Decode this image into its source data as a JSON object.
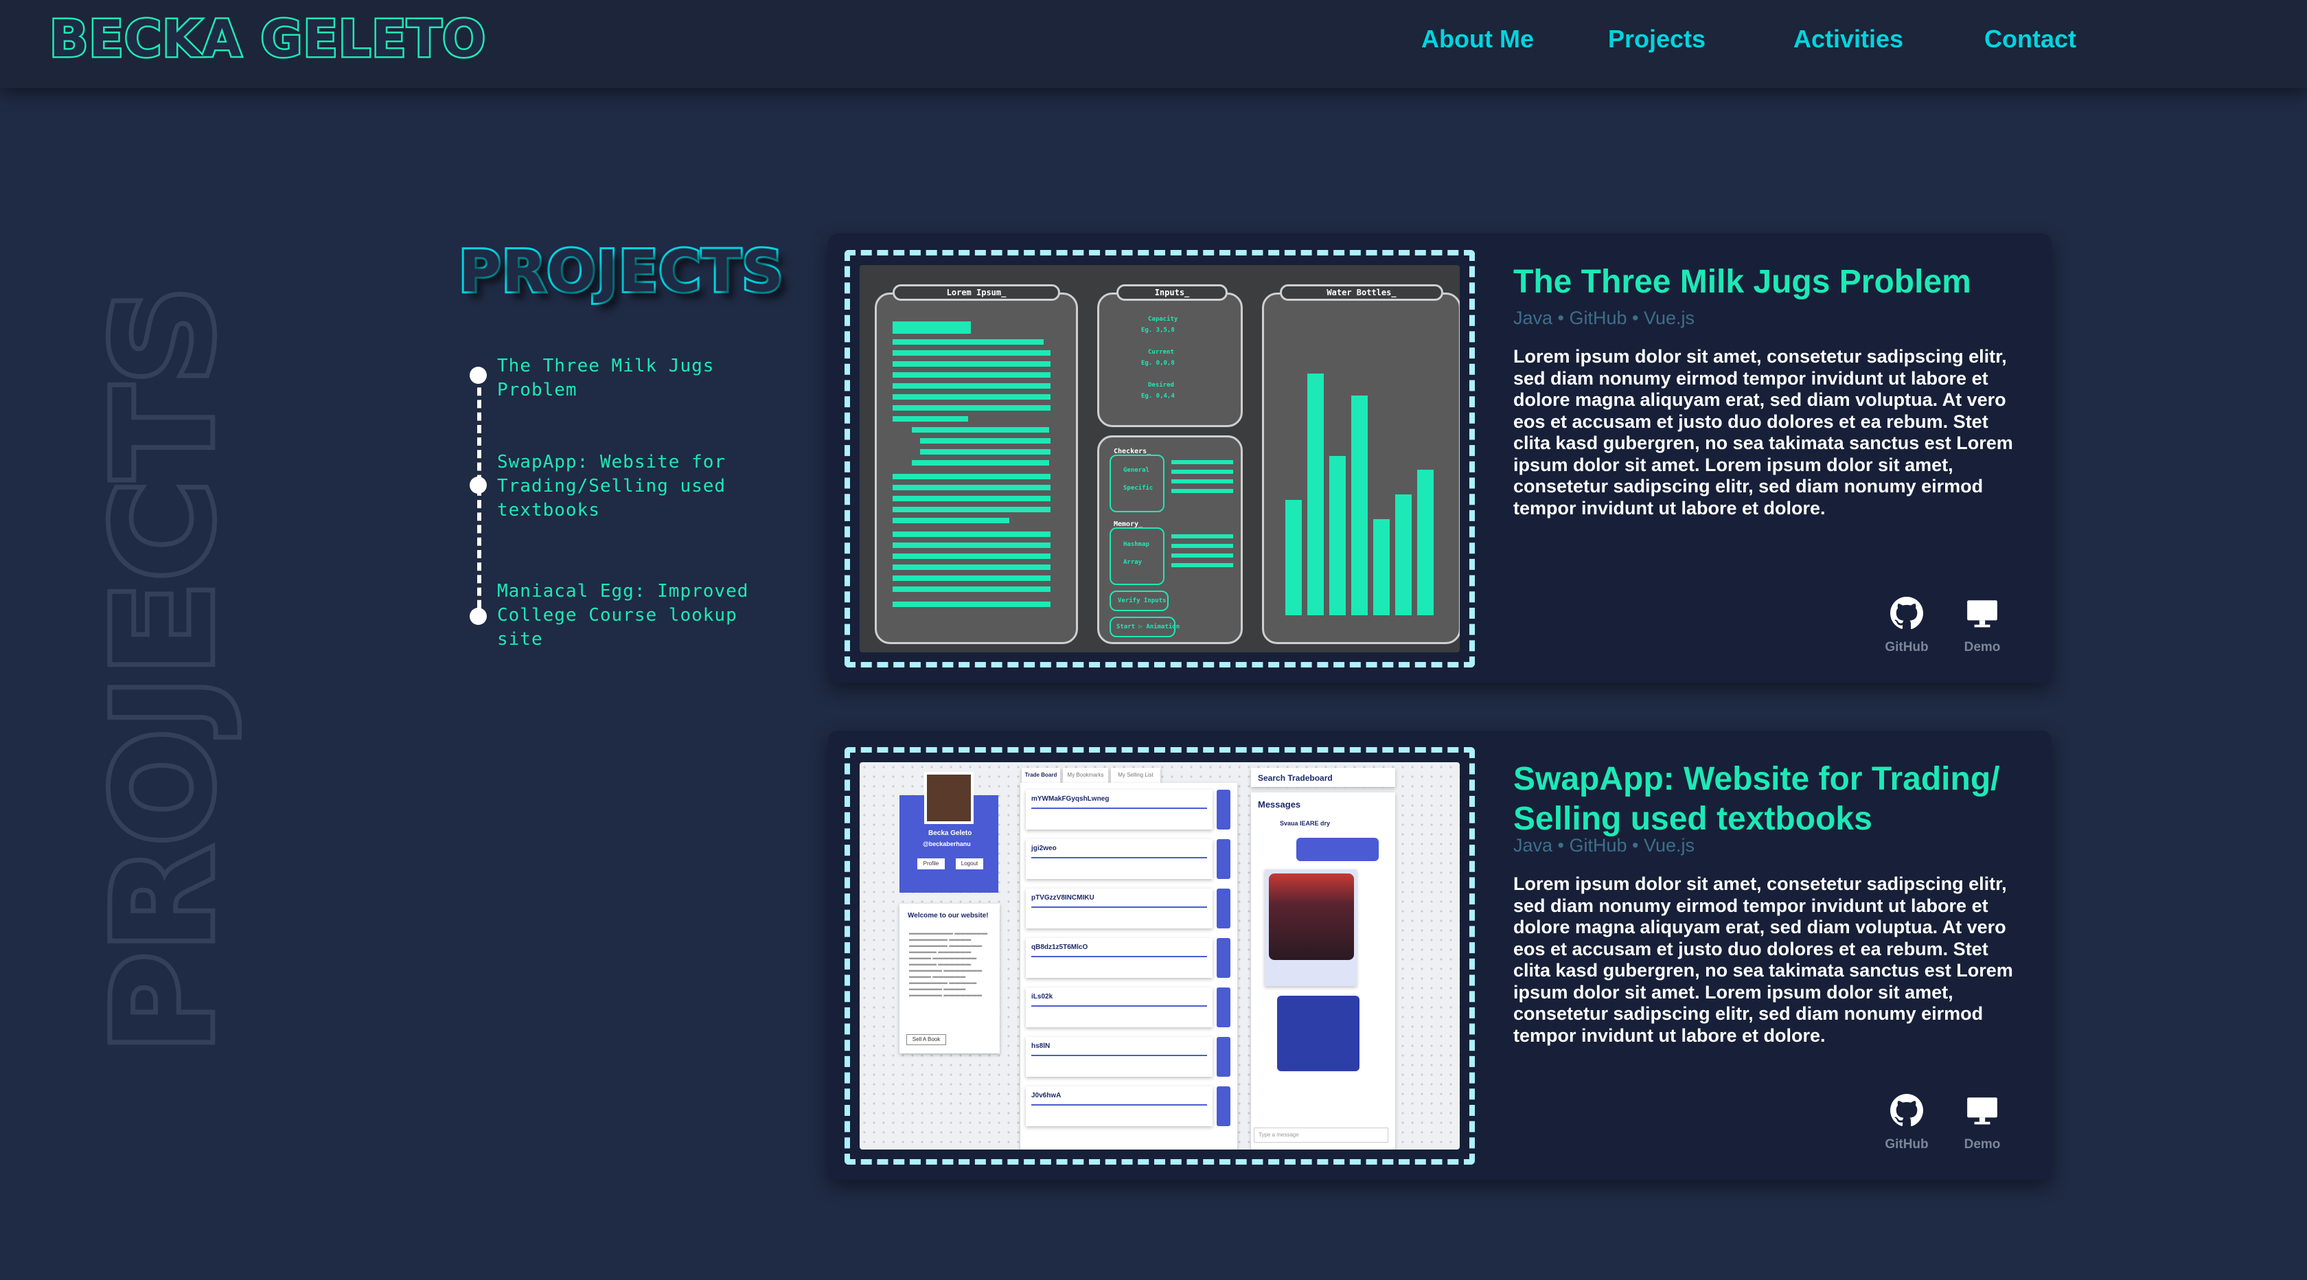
{
  "header": {
    "brand": "BECKA GELETO",
    "nav": [
      {
        "label": "About Me"
      },
      {
        "label": "Projects"
      },
      {
        "label": "Activities"
      },
      {
        "label": "Contact"
      }
    ]
  },
  "watermark": "PROJECTS",
  "section": {
    "title": "PROJECTS",
    "timeline": [
      "The Three Milk Jugs Problem",
      "SwapApp: Website for Trading/Selling used textbooks",
      "Maniacal Egg: Improved College Course lookup site"
    ]
  },
  "projects": [
    {
      "title": "The Three Milk Jugs Problem",
      "tags": "Java • GitHub • Vue.js",
      "description": "Lorem ipsum dolor sit amet, consetetur sadipscing elitr, sed diam nonumy eirmod tempor invidunt ut labore et dolore magna aliquyam erat, sed diam voluptua. At vero eos et accusam et justo duo dolores et ea rebum. Stet clita kasd gubergren, no sea takimata sanctus est Lorem ipsum dolor sit amet. Lorem ipsum dolor sit amet, consetetur sadipscing elitr, sed diam nonumy eirmod tempor invidunt ut labore et dolore.",
      "github_label": "GitHub",
      "demo_label": "Demo",
      "preview": {
        "panel_left": "Lorem Ipsum_",
        "panel_mid": "Inputs_",
        "panel_right": "Water Bottles_",
        "inputs": [
          {
            "label": "Capacity",
            "value": "Eg. 3,5,8"
          },
          {
            "label": "Current",
            "value": "Eg. 0,0,8"
          },
          {
            "label": "Desired",
            "value": "Eg. 0,4,4"
          }
        ],
        "checkers_label": "Checkers_",
        "checkers": [
          "General",
          "Specific"
        ],
        "memory_label": "Memory_",
        "memory": [
          "Hashmap",
          "Array"
        ],
        "verify_label": "Verify Inputs",
        "start_label": "Start ▷ Animation",
        "bars": [
          0.42,
          0.88,
          0.58,
          0.8,
          0.35,
          0.44,
          0.53
        ]
      }
    },
    {
      "title": "SwapApp: Website for Trading/ Selling used textbooks",
      "tags": "Java • GitHub • Vue.js",
      "description": "Lorem ipsum dolor sit amet, consetetur sadipscing elitr, sed diam nonumy eirmod tempor invidunt ut labore et dolore magna aliquyam erat, sed diam voluptua. At vero eos et accusam et justo duo dolores et ea rebum. Stet clita kasd gubergren, no sea takimata sanctus est Lorem ipsum dolor sit amet. Lorem ipsum dolor sit amet, consetetur sadipscing elitr, sed diam nonumy eirmod tempor invidunt ut labore et dolore.",
      "github_label": "GitHub",
      "demo_label": "Demo",
      "preview": {
        "profile_name": "Becka Geleto",
        "profile_handle": "@beckaberhanu",
        "profile_btn": "Profile",
        "logout_btn": "Logout",
        "welcome_title": "Welcome to our website!",
        "sell_btn": "Sell A Book",
        "tabs": [
          "Trade Board",
          "My Bookmarks",
          "My Selling List"
        ],
        "listings": [
          "mYWMakFGyqshLwneg",
          "jgi2weo",
          "pTVGzzV8INCMIKU",
          "qB8dz1z5T6MlcO",
          "iLs02k",
          "hs8lN",
          "J0v6hwA"
        ],
        "search_label": "Search Tradeboard",
        "messages_label": "Messages",
        "chat_name": "Svaua IEARE dry",
        "input_placeholder": "Type a message"
      }
    }
  ]
}
